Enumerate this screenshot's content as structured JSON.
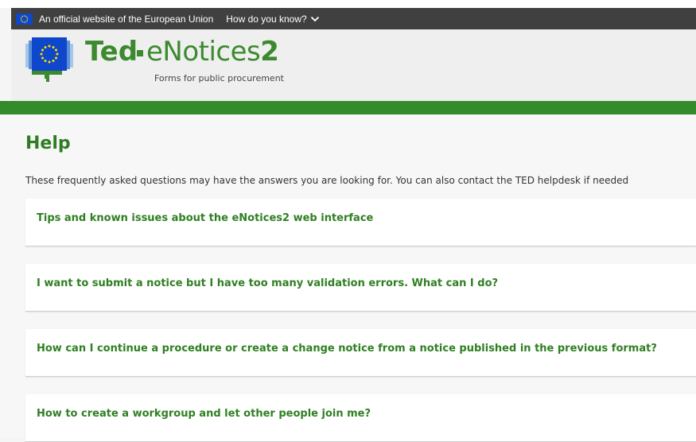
{
  "eu_banner": {
    "official_text": "An official website of the European Union",
    "how_text": "How do you know?",
    "flag_color": "#0e47cb"
  },
  "header": {
    "brand_ted": "Ted",
    "brand_enotices_prefix": "eNotices",
    "brand_enotices_suffix": "2",
    "tagline": "Forms for public procurement"
  },
  "main": {
    "title": "Help",
    "intro": "These frequently asked questions may have the answers you are looking for. You can also contact the TED helpdesk if needed",
    "faqs": [
      "Tips and known issues about the eNotices2 web interface",
      "I want to submit a notice but I have too many validation errors. What can I do?",
      "How can I continue a procedure or create a change notice from a notice published in the previous format?",
      "How to create a workgroup and let other people join me?"
    ]
  },
  "colors": {
    "brand_green": "#338b2b",
    "link_green": "#2f7f22",
    "banner_dark": "#404040"
  }
}
